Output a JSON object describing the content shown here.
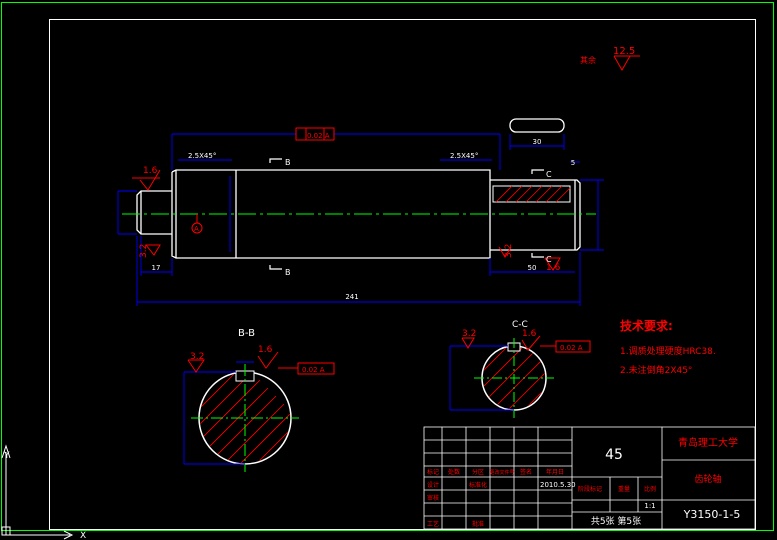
{
  "drawing": {
    "section_bb": "B-B",
    "section_cc": "C-C",
    "cut_label_b": "B",
    "cut_label_c": "C",
    "datum_a": "A",
    "roughness_other": "12.5",
    "roughness_other_prefix": "其余",
    "roughness_16": "1.6",
    "roughness_32": "3.2",
    "dim_overall": "241",
    "dim_17": "17",
    "dim_50": "50",
    "dim_5": "5",
    "dim_keyway_len": "30",
    "chamfer_left": "2.5X45°",
    "chamfer_right": "2.5X45°",
    "tol_runout": "0.02 A",
    "tol_sym_b": "0.02 A",
    "tol_sym_c": "0.02 A"
  },
  "notes": {
    "title": "技术要求:",
    "items": [
      "1.调质处理硬度HRC38.",
      "2.未注倒角2X45°"
    ]
  },
  "title_block": {
    "material": "45",
    "university": "青岛理工大学",
    "part_name": "齿轮轴",
    "drawing_number": "Y3150-1-5",
    "date": "2010.5.30",
    "scale": "1:1",
    "sheet": "共5张 第5张",
    "design_label": "设计",
    "std_label": "标准化",
    "process_label": "工艺",
    "approve_label": "批准",
    "check_label": "审核",
    "mark_label": "标记",
    "count_label": "处数",
    "zone_label": "分区",
    "change_label": "更改文件号",
    "sign_label": "签名",
    "ymd_label": "年月日",
    "stage_label": "阶段标记",
    "weight_label": "重量",
    "ratio_label": "比例"
  },
  "ucs": {
    "x": "X",
    "y": "Y"
  },
  "colors": {
    "background": "#000000",
    "border": "#00ff00",
    "outline": "#ffffff",
    "dimension": "#0000ff",
    "hatch": "#ff0000",
    "text_red": "#ff0000",
    "centerline": "#00ff00"
  }
}
